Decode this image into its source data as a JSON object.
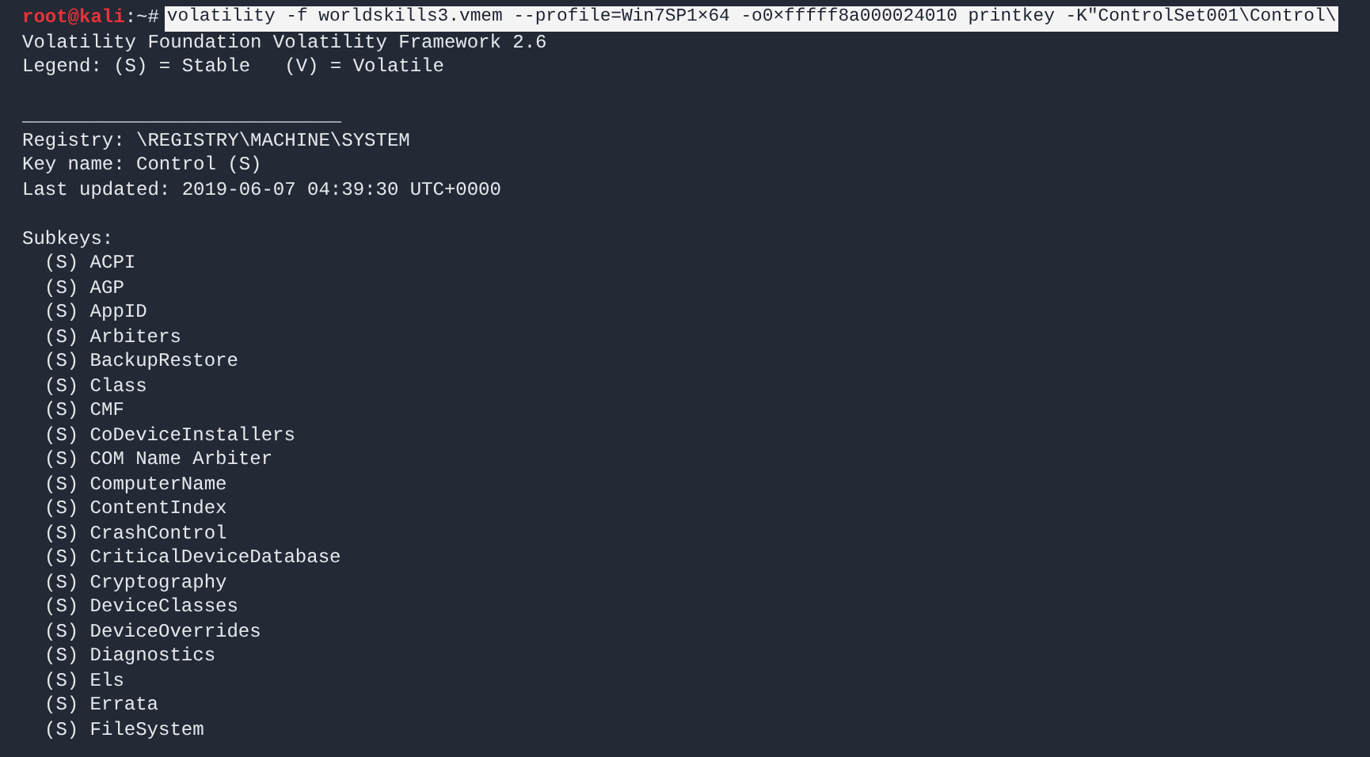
{
  "prompt": {
    "user_host": "root@kali",
    "suffix": ":~#"
  },
  "command": "volatility -f worldskills3.vmem --profile=Win7SP1×64 -o0×fffff8a000024010 printkey -K\"ControlSet001\\Control\\",
  "header_lines": [
    "Volatility Foundation Volatility Framework 2.6",
    "Legend: (S) = Stable   (V) = Volatile"
  ],
  "separator": "____________________________",
  "key_info": [
    "Registry: \\REGISTRY\\MACHINE\\SYSTEM",
    "Key name: Control (S)",
    "Last updated: 2019-06-07 04:39:30 UTC+0000"
  ],
  "subkeys_label": "Subkeys:",
  "subkeys": [
    "(S) ACPI",
    "(S) AGP",
    "(S) AppID",
    "(S) Arbiters",
    "(S) BackupRestore",
    "(S) Class",
    "(S) CMF",
    "(S) CoDeviceInstallers",
    "(S) COM Name Arbiter",
    "(S) ComputerName",
    "(S) ContentIndex",
    "(S) CrashControl",
    "(S) CriticalDeviceDatabase",
    "(S) Cryptography",
    "(S) DeviceClasses",
    "(S) DeviceOverrides",
    "(S) Diagnostics",
    "(S) Els",
    "(S) Errata",
    "(S) FileSystem"
  ]
}
